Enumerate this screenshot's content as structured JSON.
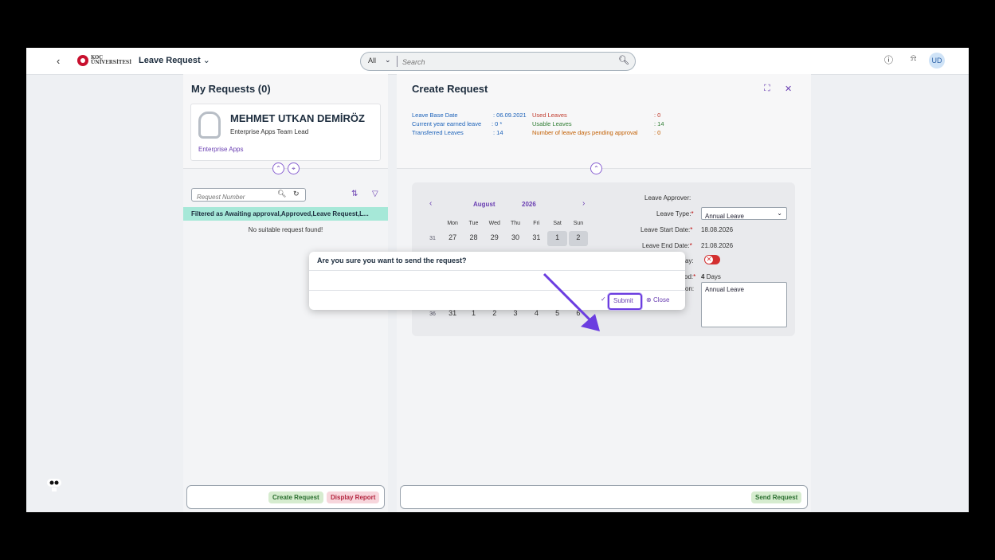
{
  "shell": {
    "back_icon": "chevron-left-icon",
    "logo_text": "KOÇ ÜNİVERSİTESİ",
    "app_title": "Leave Request",
    "search_scope": "All",
    "search_placeholder": "Search",
    "avatar_initials": "UD"
  },
  "left_panel": {
    "title": "My Requests (0)",
    "profile": {
      "name": "MEHMET UTKAN DEMİRÖZ",
      "role": "Enterprise Apps Team Lead",
      "department": "Enterprise Apps"
    },
    "request_number_placeholder": "Request Number",
    "filter_text": "Filtered as Awaiting approval,Approved,Leave Request,L...",
    "empty_text": "No suitable request found!",
    "footer": {
      "create_label": "Create Request",
      "report_label": "Display Report"
    }
  },
  "right_panel": {
    "title": "Create Request",
    "info": {
      "leave_base_date_label": "Leave Base Date",
      "leave_base_date_value": ": 06.09.2021",
      "earned_label": "Current year earned leave",
      "earned_value": ": 0 *",
      "transferred_label": "Transferred Leaves",
      "transferred_value": ": 14",
      "used_label": "Used Leaves",
      "used_value": ": 0",
      "usable_label": "Usable Leaves",
      "usable_value": ": 14",
      "pending_label": "Number of leave days pending approval",
      "pending_value": ": 0"
    },
    "calendar": {
      "month": "August",
      "year": "2026",
      "weekdays": [
        "Mon",
        "Tue",
        "Wed",
        "Thu",
        "Fri",
        "Sat",
        "Sun"
      ],
      "row1": {
        "week": "31",
        "days": [
          "27",
          "28",
          "29",
          "30",
          "31",
          "1",
          "2"
        ]
      },
      "row_last": {
        "week": "36",
        "days": [
          "31",
          "1",
          "2",
          "3",
          "4",
          "5",
          "6"
        ]
      }
    },
    "form": {
      "approver_label": "Leave Approver:",
      "type_label": "Leave Type:",
      "type_value": "Annual Leave",
      "start_label": "Leave Start Date:",
      "start_value": "18.08.2026",
      "end_label": "Leave End Date:",
      "end_value": "21.08.2026",
      "halfday_label_partial": "ay:",
      "period_label_partial": "od:",
      "period_value": "4",
      "period_unit": "Days",
      "explanation_label_partial": "on:",
      "explanation_value": "Annual Leave"
    },
    "footer": {
      "send_label": "Send Request"
    }
  },
  "dialog": {
    "title": "Are you sure you want to send the request?",
    "submit_label": "Submit",
    "close_label": "Close"
  },
  "colors": {
    "accent": "#6a3fb2",
    "highlight": "#6b3de0",
    "filter_bg": "#a6e8d8"
  }
}
